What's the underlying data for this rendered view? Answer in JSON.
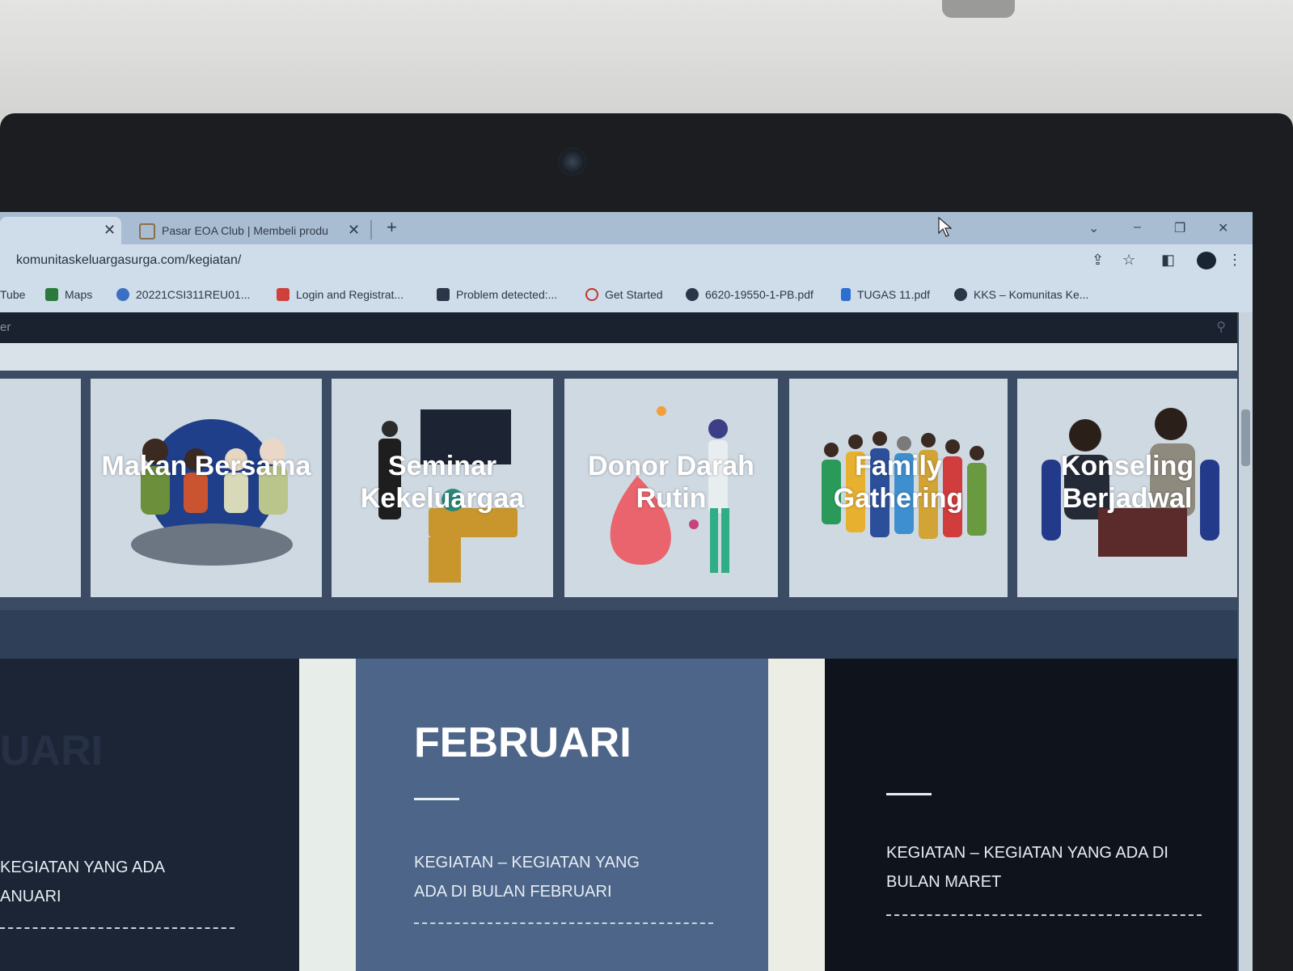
{
  "browser": {
    "tabs": [
      {
        "label": ""
      },
      {
        "label": "Pasar EOA Club | Membeli produ"
      }
    ],
    "new_tab": "+",
    "close_glyph": "✕",
    "url": "komunitaskeluargasurga.com/kegiatan/",
    "window_controls": {
      "dropdown": "⌄",
      "minimize": "–",
      "restore": "❐",
      "close": "✕"
    },
    "bookmarks": [
      {
        "label": "Tube",
        "icon": "youtube-icon",
        "color": "#c4302b"
      },
      {
        "label": "Maps",
        "icon": "maps-icon",
        "color": "#2a7a3b"
      },
      {
        "label": "20221CSI311REU01...",
        "icon": "classroom-icon",
        "color": "#3b6fc4"
      },
      {
        "label": "Login and Registrat...",
        "icon": "login-icon",
        "color": "#d0403b"
      },
      {
        "label": "Problem detected:...",
        "icon": "video-icon",
        "color": "#2b3748"
      },
      {
        "label": "Get Started",
        "icon": "swirl-icon",
        "color": "#c0392b"
      },
      {
        "label": "6620-19550-1-PB.pdf",
        "icon": "globe-icon",
        "color": "#2b3748"
      },
      {
        "label": "TUGAS 11.pdf",
        "icon": "file-icon",
        "color": "#2d6fd0"
      },
      {
        "label": "KKS – Komunitas Ke...",
        "icon": "globe-icon",
        "color": "#2b3748"
      }
    ]
  },
  "page": {
    "nav_text": "er",
    "cards": [
      {
        "label": ""
      },
      {
        "label": "Makan Bersama"
      },
      {
        "label": "Seminar Kekeluargaa"
      },
      {
        "label": "Donor Darah Rutin"
      },
      {
        "label": "Family Gathering"
      },
      {
        "label": "Konseling Berjadwal"
      }
    ],
    "months": [
      {
        "title": "UARI",
        "desc_line1": "KEGIATAN YANG ADA",
        "desc_line2": "ANUARI"
      },
      {
        "title": "FEBRUARI",
        "desc_line1": "KEGIATAN – KEGIATAN YANG",
        "desc_line2": "ADA DI BULAN FEBRUARI"
      },
      {
        "title": "",
        "desc_line1": "KEGIATAN – KEGIATAN YANG ADA DI",
        "desc_line2": "BULAN MARET"
      }
    ]
  }
}
